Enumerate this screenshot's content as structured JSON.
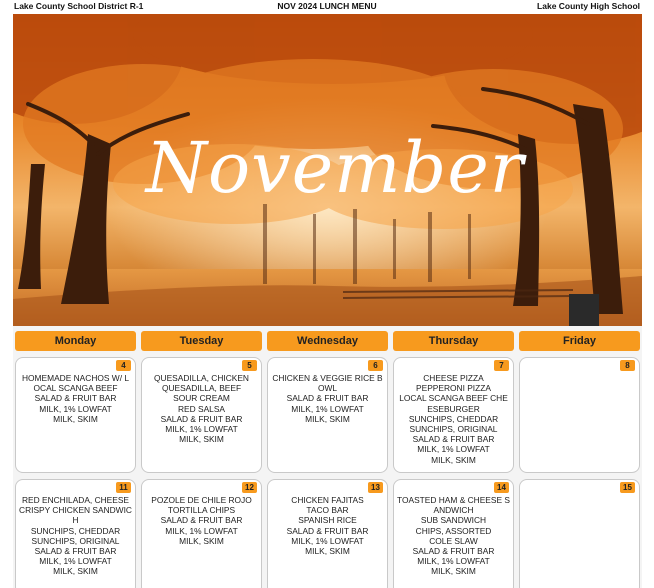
{
  "header": {
    "district": "Lake County School District R-1",
    "menu_title": "NOV 2024 LUNCH MENU",
    "school": "Lake County High School"
  },
  "hero": {
    "month_script": "November"
  },
  "days": [
    "Monday",
    "Tuesday",
    "Wednesday",
    "Thursday",
    "Friday"
  ],
  "weeks": [
    [
      {
        "date": "4",
        "lines": [
          "HOMEMADE NACHOS W/ LOCAL SCANGA BEEF",
          "SALAD & FRUIT BAR",
          "MILK, 1% LOWFAT",
          "MILK, SKIM"
        ]
      },
      {
        "date": "5",
        "lines": [
          "QUESADILLA, CHICKEN",
          "QUESADILLA, BEEF",
          "SOUR CREAM",
          "RED SALSA",
          "SALAD & FRUIT BAR",
          "MILK, 1% LOWFAT",
          "MILK, SKIM"
        ]
      },
      {
        "date": "6",
        "lines": [
          "CHICKEN & VEGGIE RICE BOWL",
          "SALAD & FRUIT BAR",
          "MILK, 1% LOWFAT",
          "MILK, SKIM"
        ]
      },
      {
        "date": "7",
        "lines": [
          "CHEESE PIZZA",
          "PEPPERONI PIZZA",
          "LOCAL SCANGA BEEF CHEESEBURGER",
          "SUNCHIPS, CHEDDAR",
          "SUNCHIPS, ORIGINAL",
          "SALAD & FRUIT BAR",
          "MILK, 1% LOWFAT",
          "MILK, SKIM"
        ]
      },
      {
        "date": "8",
        "lines": []
      }
    ],
    [
      {
        "date": "11",
        "lines": [
          "RED ENCHILADA, CHEESE",
          "CRISPY CHICKEN SANDWICH",
          "SUNCHIPS, CHEDDAR",
          "SUNCHIPS, ORIGINAL",
          "SALAD & FRUIT BAR",
          "MILK, 1% LOWFAT",
          "MILK, SKIM"
        ]
      },
      {
        "date": "12",
        "lines": [
          "POZOLE DE CHILE ROJO",
          "TORTILLA CHIPS",
          "SALAD & FRUIT BAR",
          "MILK, 1% LOWFAT",
          "MILK, SKIM"
        ]
      },
      {
        "date": "13",
        "lines": [
          "CHICKEN FAJITAS",
          "TACO BAR",
          "SPANISH RICE",
          "SALAD & FRUIT BAR",
          "MILK, 1% LOWFAT",
          "MILK, SKIM"
        ]
      },
      {
        "date": "14",
        "lines": [
          "TOASTED HAM & CHEESE SANDWICH",
          "SUB SANDWICH",
          "CHIPS, ASSORTED",
          "COLE SLAW",
          "SALAD & FRUIT BAR",
          "MILK, 1% LOWFAT",
          "MILK, SKIM"
        ]
      },
      {
        "date": "15",
        "lines": []
      }
    ]
  ],
  "colors": {
    "accent": "#f79a1e"
  }
}
